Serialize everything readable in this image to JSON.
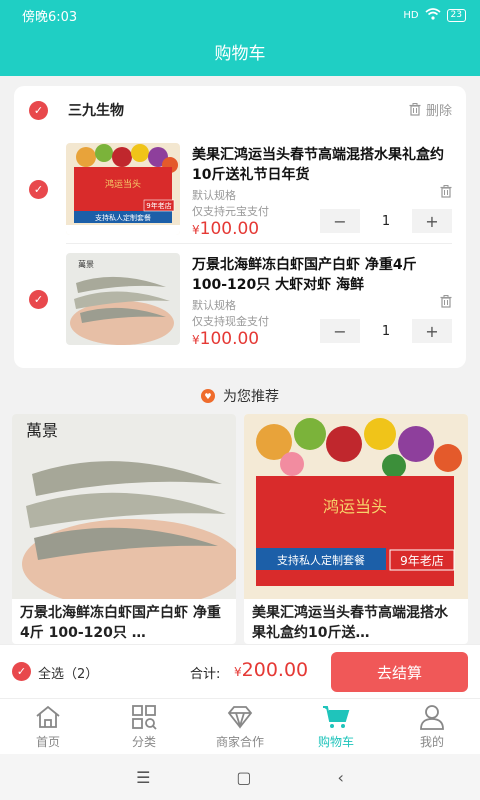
{
  "status_bar": {
    "time": "傍晚6:03",
    "signal": "HD",
    "battery": "23"
  },
  "header": {
    "title": "购物车"
  },
  "cart": {
    "store_name": "三九生物",
    "delete_label": "删除",
    "items": [
      {
        "title": "美果汇鸿运当头春节高端混搭水果礼盒约10斤送礼节日年货",
        "spec": "默认规格",
        "payment": "仅支持元宝支付",
        "price_symbol": "¥",
        "price": "100.00",
        "quantity": "1",
        "image_text": "9年老店",
        "image_banner": "支持私人定制套餐"
      },
      {
        "title": "万景北海鲜冻白虾国产白虾 净重4斤 100-120只 大虾对虾 海鲜",
        "spec": "默认规格",
        "payment": "仅支持现金支付",
        "price_symbol": "¥",
        "price": "100.00",
        "quantity": "1",
        "image_text": "萬景"
      }
    ]
  },
  "recommend": {
    "title": "为您推荐",
    "items": [
      {
        "name": "万景北海鲜冻白虾国产白虾 净重4斤 100-120只 …",
        "image_text": "萬景"
      },
      {
        "name": "美果汇鸿运当头春节高端混搭水果礼盒约10斤送…",
        "image_text": "9年老店",
        "image_banner": "支持私人定制套餐",
        "image_box": "鸿运当头"
      }
    ]
  },
  "settlement": {
    "select_all": "全选（2）",
    "total_label": "合计:",
    "total_symbol": "¥",
    "total_value": "200.00",
    "checkout": "去结算"
  },
  "tabbar": {
    "items": [
      {
        "label": "首页",
        "icon": "home-icon"
      },
      {
        "label": "分类",
        "icon": "category-icon"
      },
      {
        "label": "商家合作",
        "icon": "diamond-icon"
      },
      {
        "label": "购物车",
        "icon": "cart-icon"
      },
      {
        "label": "我的",
        "icon": "user-icon"
      }
    ]
  },
  "colors": {
    "accent": "#1fcfc4",
    "price": "#e53935",
    "check": "#e8484c",
    "checkout": "#f05858"
  }
}
